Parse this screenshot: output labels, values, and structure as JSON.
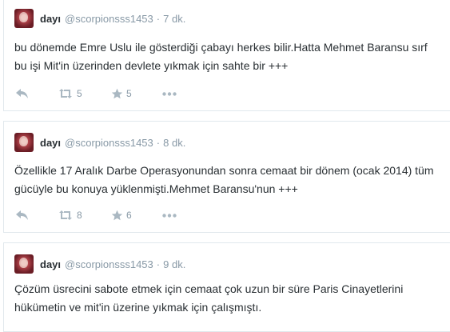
{
  "tweets": [
    {
      "name": "dayı",
      "handle": "@scorpionsss1453",
      "separator": "·",
      "time": "7 dk.",
      "text": "bu dönemde Emre Uslu ile gösterdiği çabayı herkes bilir.Hatta Mehmet Baransu sırf bu işi Mit'in üzerinden devlete yıkmak için sahte bir +++",
      "retweets": "5",
      "favorites": "5"
    },
    {
      "name": "dayı",
      "handle": "@scorpionsss1453",
      "separator": "·",
      "time": "8 dk.",
      "text": "Özellikle 17 Aralık Darbe Operasyonundan sonra cemaat bir dönem (ocak 2014) tüm gücüyle bu konuya yüklenmişti.Mehmet Baransu'nun +++",
      "retweets": "8",
      "favorites": "6"
    },
    {
      "name": "dayı",
      "handle": "@scorpionsss1453",
      "separator": "·",
      "time": "9 dk.",
      "text": "Çözüm üsrecini sabote etmek için cemaat çok uzun bir süre Paris Cinayetlerini hükümetin ve mit'in üzerine yıkmak için çalışmıştı."
    }
  ],
  "icons": {
    "reply": "reply-icon",
    "retweet": "retweet-icon",
    "favorite": "star-icon",
    "more": "more-icon"
  },
  "colors": {
    "text": "#292f33",
    "muted": "#8899a6",
    "icon": "#aab8c2",
    "border": "#e1e8ed"
  }
}
